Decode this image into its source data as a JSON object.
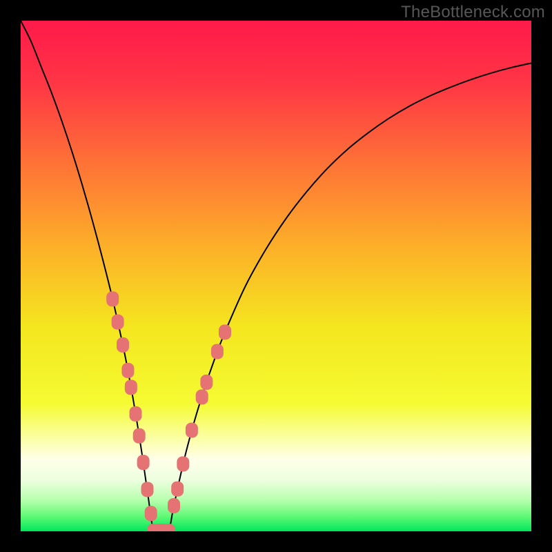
{
  "watermark": "TheBottleneck.com",
  "chart_data": {
    "type": "line",
    "title": "",
    "xlabel": "",
    "ylabel": "",
    "xlim": [
      0,
      100
    ],
    "ylim": [
      0,
      100
    ],
    "grid": false,
    "legend": false,
    "background_gradient": {
      "stops": [
        {
          "offset": 0.0,
          "color": "#ff1a4a"
        },
        {
          "offset": 0.12,
          "color": "#ff3545"
        },
        {
          "offset": 0.28,
          "color": "#fe7236"
        },
        {
          "offset": 0.45,
          "color": "#fcb228"
        },
        {
          "offset": 0.6,
          "color": "#f4e61f"
        },
        {
          "offset": 0.75,
          "color": "#f5fb32"
        },
        {
          "offset": 0.82,
          "color": "#fbffa8"
        },
        {
          "offset": 0.86,
          "color": "#ffffe9"
        },
        {
          "offset": 0.9,
          "color": "#ecffde"
        },
        {
          "offset": 0.94,
          "color": "#b5ffac"
        },
        {
          "offset": 0.97,
          "color": "#62f976"
        },
        {
          "offset": 1.0,
          "color": "#00e65b"
        }
      ]
    },
    "series": [
      {
        "name": "bottleneck-curve",
        "color": "#000000",
        "x": [
          0,
          2,
          4,
          6,
          8,
          10,
          12,
          14,
          16,
          18,
          20,
          21,
          22,
          23,
          24,
          25,
          26,
          27,
          28,
          29,
          30,
          32,
          34,
          36,
          38,
          40,
          44,
          48,
          52,
          56,
          60,
          64,
          68,
          72,
          76,
          80,
          84,
          88,
          92,
          96,
          100
        ],
        "y": [
          100,
          96,
          91,
          86,
          80.5,
          74.5,
          68,
          61,
          53.5,
          45.5,
          36.5,
          31.5,
          26,
          20,
          13.5,
          6.5,
          0,
          0,
          0,
          0,
          5,
          14,
          21.5,
          28,
          33.8,
          39,
          48,
          55.2,
          61.3,
          66.5,
          71,
          74.8,
          78,
          80.8,
          83.2,
          85.2,
          86.9,
          88.4,
          89.7,
          90.8,
          91.7
        ]
      }
    ],
    "markers": {
      "name": "highlighted-points",
      "color": "#e57373",
      "shape": "rounded-rect",
      "points": [
        {
          "x": 18.0,
          "y": 45.5
        },
        {
          "x": 19.0,
          "y": 41.0
        },
        {
          "x": 20.0,
          "y": 36.5
        },
        {
          "x": 21.0,
          "y": 31.5
        },
        {
          "x": 21.6,
          "y": 28.2
        },
        {
          "x": 22.5,
          "y": 23.0
        },
        {
          "x": 23.2,
          "y": 18.7
        },
        {
          "x": 24.0,
          "y": 13.5
        },
        {
          "x": 24.8,
          "y": 8.2
        },
        {
          "x": 25.5,
          "y": 3.5
        },
        {
          "x": 26.0,
          "y": 0.0
        },
        {
          "x": 27.0,
          "y": 0.0
        },
        {
          "x": 28.0,
          "y": 0.0
        },
        {
          "x": 29.0,
          "y": 0.0
        },
        {
          "x": 30.0,
          "y": 5.0
        },
        {
          "x": 30.7,
          "y": 8.3
        },
        {
          "x": 31.8,
          "y": 13.2
        },
        {
          "x": 33.5,
          "y": 19.8
        },
        {
          "x": 35.5,
          "y": 26.3
        },
        {
          "x": 36.4,
          "y": 29.2
        },
        {
          "x": 38.5,
          "y": 35.2
        },
        {
          "x": 40.0,
          "y": 39.0
        }
      ]
    }
  }
}
